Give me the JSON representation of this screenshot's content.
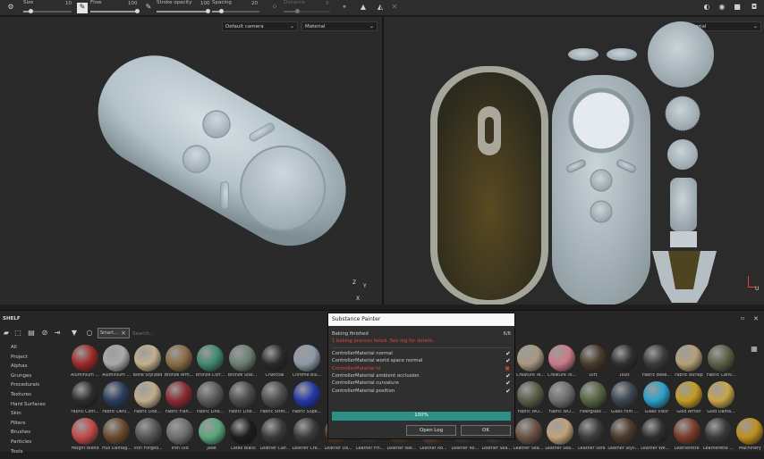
{
  "toolbar": {
    "size_label": "Size",
    "size_value": "10",
    "size_fraction": 0.15,
    "flow_label": "Flow",
    "flow_value": "100",
    "flow_fraction": 1.0,
    "stroke_opacity_label": "Stroke opacity",
    "stroke_opacity_value": "100",
    "stroke_opacity_fraction": 1.0,
    "spacing_label": "Spacing",
    "spacing_value": "20",
    "spacing_fraction": 0.2,
    "distance_label": "Distance",
    "distance_value": "8",
    "distance_fraction": 0.3
  },
  "viewport_3d": {
    "camera_select": "Default camera",
    "channel_select": "Material",
    "axis_z": "Z",
    "axis_y": "Y",
    "axis_x": "X"
  },
  "viewport_2d": {
    "channel_select": "Material",
    "axis_u": "U"
  },
  "shelf": {
    "title": "SHELF",
    "search_placeholder": "Search...",
    "filter_tag": "Smart...",
    "filter_close": "×",
    "categories": [
      "All",
      "Project",
      "Alphas",
      "Grunges",
      "Procedurals",
      "Textures",
      "Hard Surfaces",
      "Skin",
      "Filters",
      "Brushes",
      "Particles",
      "Tools"
    ],
    "rows": [
      [
        {
          "label": "Aluminium ...",
          "color": "#9e2a28"
        },
        {
          "label": "Aluminium ...",
          "color": "#a9a9a9"
        },
        {
          "label": "Bone Stylized",
          "color": "#c3b08c"
        },
        {
          "label": "Bronze Arm...",
          "color": "#8a6c45"
        },
        {
          "label": "Bronze Corr...",
          "color": "#3f8a6e"
        },
        {
          "label": "Bronze Stat...",
          "color": "#6c7f72"
        },
        {
          "label": "Charcoal",
          "color": "#2a2a2a"
        },
        {
          "label": "Chrome Blu...",
          "color": "#8e9aa8"
        },
        {
          "label": "Creature Te...",
          "color": "#a89880"
        },
        {
          "label": "Creature To...",
          "color": "#c97a86"
        },
        {
          "label": "Dirt",
          "color": "#4a3b2c"
        },
        {
          "label": "Dust",
          "color": "#2e2e2e"
        },
        {
          "label": "Fabric Base...",
          "color": "#3a3a3a"
        },
        {
          "label": "Fabric Burlap",
          "color": "#b59f78"
        },
        {
          "label": "Fabric Canv...",
          "color": "#596046"
        }
      ],
      [
        {
          "label": "Fabric Com...",
          "color": "#2c2c2c"
        },
        {
          "label": "Fabric Deni...",
          "color": "#2a3d5e"
        },
        {
          "label": "Fabric Dob...",
          "color": "#bfae8a"
        },
        {
          "label": "Fabric Flan...",
          "color": "#8a2a33"
        },
        {
          "label": "Fabric Line...",
          "color": "#5b5b5b"
        },
        {
          "label": "Fabric Line...",
          "color": "#4d4d4d"
        },
        {
          "label": "Fabric Stret...",
          "color": "#4f4f4f"
        },
        {
          "label": "Fabric Supe...",
          "color": "#2439a8"
        },
        {
          "label": "Fabric WO...",
          "color": "#5a5d46"
        },
        {
          "label": "Fabric WO...",
          "color": "#6e6e6e"
        },
        {
          "label": "Fiberglass ...",
          "color": "#566442"
        },
        {
          "label": "Glass Film ...",
          "color": "#3b4651"
        },
        {
          "label": "Glass Visor",
          "color": "#2aa0c9"
        },
        {
          "label": "Gold Armor",
          "color": "#c39b24"
        },
        {
          "label": "Gold Dama...",
          "color": "#c9a54a"
        }
      ],
      [
        {
          "label": "Height Blend",
          "color": "#c24a4a"
        },
        {
          "label": "Hull Damag...",
          "color": "#6a4a2e"
        },
        {
          "label": "Iron Forged...",
          "color": "#555555"
        },
        {
          "label": "Iron Old",
          "color": "#6e6e6e"
        },
        {
          "label": "Jade",
          "color": "#5aa57a"
        },
        {
          "label": "Latex Black",
          "color": "#1d1d1d"
        },
        {
          "label": "Leather Calf...",
          "color": "#3a3a3a"
        },
        {
          "label": "Leather Cre...",
          "color": "#3b3b3b"
        },
        {
          "label": "Leather Da...",
          "color": "#4d3b2a"
        },
        {
          "label": "Leather Fin...",
          "color": "#3a3a3a"
        },
        {
          "label": "Leather Nat...",
          "color": "#4a3a2b"
        },
        {
          "label": "Leather Ro...",
          "color": "#5a4030"
        },
        {
          "label": "Leather Ro...",
          "color": "#3a3a3a"
        },
        {
          "label": "Leather Sea...",
          "color": "#3d3d3d"
        },
        {
          "label": "Leather Sea...",
          "color": "#6a5242"
        },
        {
          "label": "Leather Sea...",
          "color": "#c2a27a"
        },
        {
          "label": "Leather Sofa",
          "color": "#3b3b3b"
        },
        {
          "label": "Leather Styli...",
          "color": "#4d3a2a"
        },
        {
          "label": "Leather We...",
          "color": "#2e2e2e"
        },
        {
          "label": "Leatherette",
          "color": "#7a3b2a"
        },
        {
          "label": "Leatherette ...",
          "color": "#3a3a3a"
        },
        {
          "label": "Machinery",
          "color": "#c08e1e"
        }
      ]
    ]
  },
  "dialog": {
    "title": "Substance Painter",
    "status": "Baking finished",
    "count": "6/6",
    "error": "1 baking process failed. See log for details.",
    "items": [
      {
        "label": "ControllerMaterial normal",
        "ok": true
      },
      {
        "label": "ControllerMaterial world space normal",
        "ok": true
      },
      {
        "label": "ControllerMaterial id",
        "ok": false
      },
      {
        "label": "ControllerMaterial ambient occlusion",
        "ok": true
      },
      {
        "label": "ControllerMaterial curvature",
        "ok": true
      },
      {
        "label": "ControllerMaterial position",
        "ok": true
      }
    ],
    "progress_text": "100%",
    "progress_fraction": 1.0,
    "open_log_label": "Open Log",
    "ok_label": "OK"
  },
  "colors": {
    "error": "#d9473f",
    "progress": "#2d8f86",
    "model": "#b9c6cc"
  }
}
